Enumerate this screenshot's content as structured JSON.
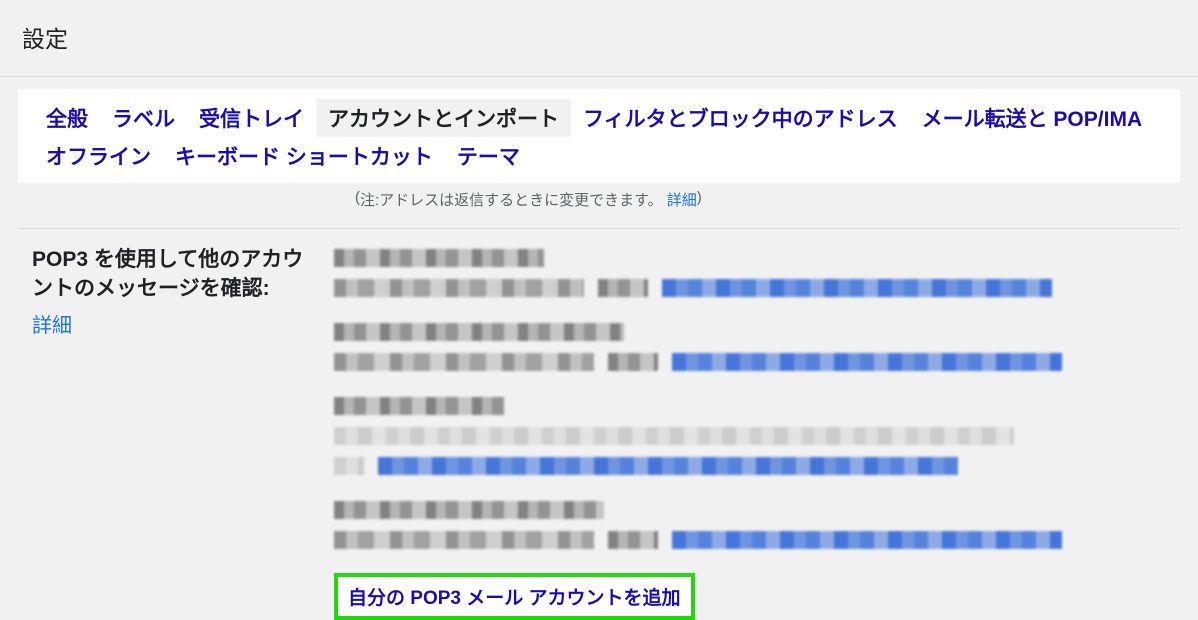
{
  "header": {
    "title": "設定"
  },
  "tabs": {
    "general": "全般",
    "labels": "ラベル",
    "inbox": "受信トレイ",
    "accounts": "アカウントとインポート",
    "filters": "フィルタとブロック中のアドレス",
    "forwarding": "メール転送と POP/IMA",
    "offline": "オフライン",
    "keyboard": "キーボード ショートカット",
    "themes": "テーマ"
  },
  "note": {
    "open_paren": "(",
    "prefix": "注: ",
    "text": "アドレスは返信するときに変更できます。",
    "detail": "詳細",
    "close_paren": ")"
  },
  "pop3_section": {
    "label": "POP3 を使用して他のアカウントのメッセージを確認:",
    "detail_link": "詳細",
    "add_button": "自分の POP3 メール アカウントを追加"
  }
}
